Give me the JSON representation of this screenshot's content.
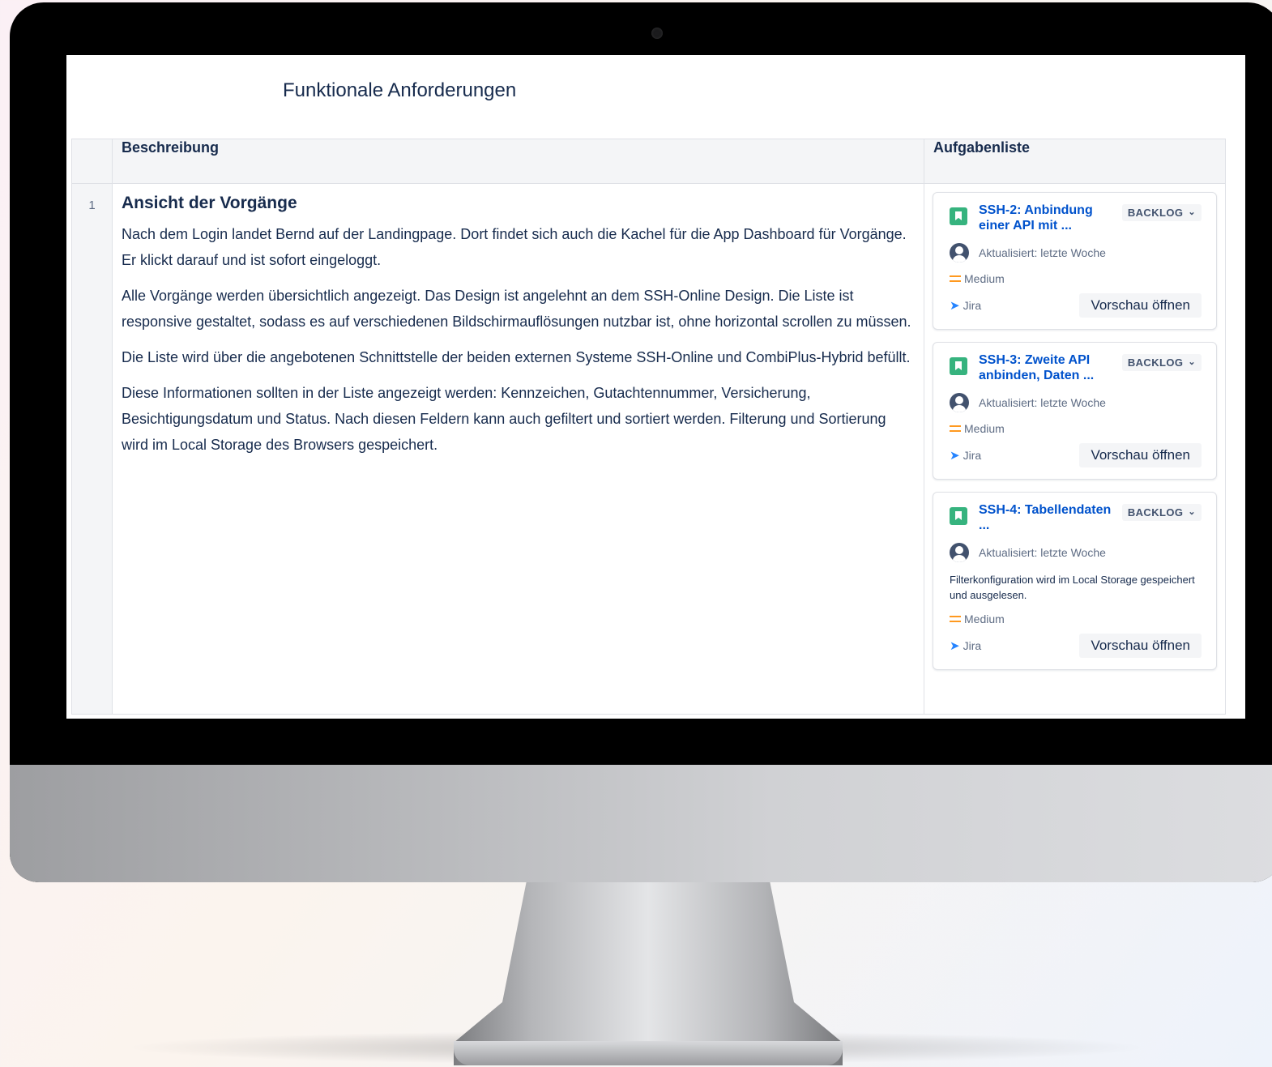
{
  "page": {
    "title": "Funktionale Anforderungen"
  },
  "table": {
    "columns": {
      "description": "Beschreibung",
      "tasks": "Aufgabenliste"
    },
    "rows": [
      {
        "number": "1",
        "heading": "Ansicht der Vorgänge",
        "paragraphs": [
          "Nach dem Login landet Bernd auf der Landingpage. Dort findet sich auch die Kachel für die App Dashboard für Vorgänge. Er klickt darauf und ist sofort eingeloggt.",
          "Alle Vorgänge werden übersichtlich angezeigt. Das Design ist angelehnt an dem SSH-Online Design. Die Liste ist responsive gestaltet, sodass es auf verschiedenen Bildschirmauflösungen nutzbar ist, ohne horizontal scrollen zu müssen.",
          "Die Liste wird über die angebotenen Schnittstelle der beiden externen Systeme SSH-Online und CombiPlus-Hybrid befüllt.",
          "Diese Informationen sollten in der Liste angezeigt werden: Kennzeichen, Gutachtennummer, Versicherung, Besichtigungsdatum und Status. Nach diesen Feldern kann auch gefiltert und sortiert werden. Filterung und Sortierung wird im Local Storage des Browsers gespeichert."
        ]
      }
    ]
  },
  "tasks": [
    {
      "title": "SSH-2: Anbindung einer API mit ...",
      "status": "BACKLOG",
      "updated": "Aktualisiert: letzte Woche",
      "summary": "",
      "priority": "Medium",
      "source": "Jira",
      "action": "Vorschau öffnen"
    },
    {
      "title": "SSH-3: Zweite API anbinden, Daten ...",
      "status": "BACKLOG",
      "updated": "Aktualisiert: letzte Woche",
      "summary": "",
      "priority": "Medium",
      "source": "Jira",
      "action": "Vorschau öffnen"
    },
    {
      "title": "SSH-4: Tabellendaten ...",
      "status": "BACKLOG",
      "updated": "Aktualisiert: letzte Woche",
      "summary": "Filterkonfiguration wird im Local Storage gespeichert und ausgelesen.",
      "priority": "Medium",
      "source": "Jira",
      "action": "Vorschau öffnen"
    }
  ],
  "icons": {
    "story": "bookmark-story-icon",
    "avatar": "user-avatar-icon",
    "priority": "medium-priority-icon",
    "source": "jira-logo-icon",
    "status": "chevron-down-icon"
  },
  "colors": {
    "link": "#0052cc",
    "story": "#36b37e",
    "priority_medium": "#ff991f",
    "jira": "#2684ff",
    "text": "#172b4d"
  }
}
